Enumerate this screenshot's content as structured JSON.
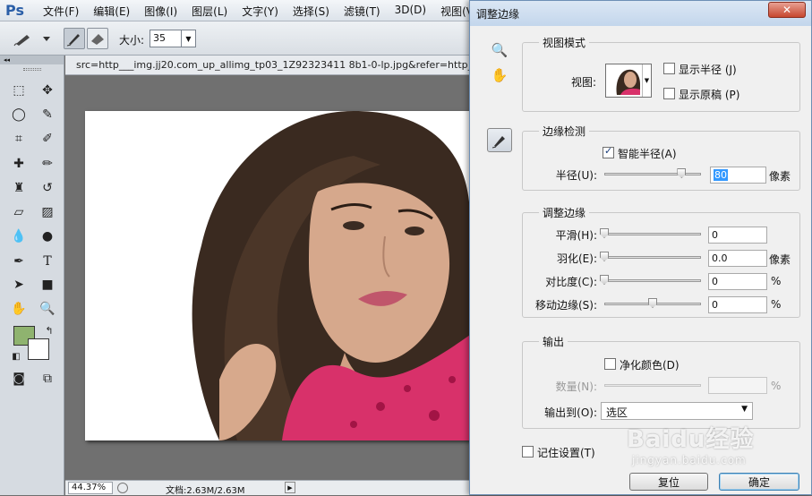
{
  "app": {
    "logo": "Ps"
  },
  "menu": [
    "文件(F)",
    "编辑(E)",
    "图像(I)",
    "图层(L)",
    "文字(Y)",
    "选择(S)",
    "滤镜(T)",
    "3D(D)",
    "视图(V)"
  ],
  "options": {
    "size_label": "大小:",
    "size_value": "35"
  },
  "document": {
    "title": "src=http___img.jj20.com_up_allimg_tp03_1Z92323411 8b1-0-lp.jpg&refer=http___",
    "zoom": "44.37%",
    "info": "文档:2.63M/2.63M"
  },
  "dialog": {
    "title": "调整边缘",
    "close": "✕",
    "view_mode": {
      "group": "视图模式",
      "view_label": "视图:",
      "show_radius": "显示半径 (J)",
      "show_radius_checked": false,
      "show_original": "显示原稿 (P)",
      "show_original_checked": false
    },
    "edge_detection": {
      "group": "边缘检测",
      "smart_radius": "智能半径(A)",
      "smart_radius_checked": true,
      "radius_label": "半径(U):",
      "radius_value": "80",
      "radius_slider": 0.8,
      "radius_unit": "像素"
    },
    "adjust_edge": {
      "group": "调整边缘",
      "smooth_label": "平滑(H):",
      "smooth_value": "0",
      "smooth_slider": 0,
      "feather_label": "羽化(E):",
      "feather_value": "0.0",
      "feather_slider": 0,
      "feather_unit": "像素",
      "contrast_label": "对比度(C):",
      "contrast_value": "0",
      "contrast_slider": 0,
      "contrast_unit": "%",
      "shift_label": "移动边缘(S):",
      "shift_value": "0",
      "shift_slider": 0.5,
      "shift_unit": "%"
    },
    "output": {
      "group": "输出",
      "decontaminate": "净化颜色(D)",
      "decontaminate_checked": false,
      "amount_label": "数量(N):",
      "amount_unit": "%",
      "output_to_label": "输出到(O):",
      "output_to_value": "选区"
    },
    "remember": "记住设置(T)",
    "remember_checked": false,
    "reset_button": "复位",
    "ok_button": "确定"
  },
  "watermark": {
    "main": "Baidu经验",
    "sub": "jingyan.baidu.com"
  },
  "colors": {
    "foreground": "#8fb36f",
    "background": "#ffffff",
    "accent": "#2b5fa8"
  }
}
